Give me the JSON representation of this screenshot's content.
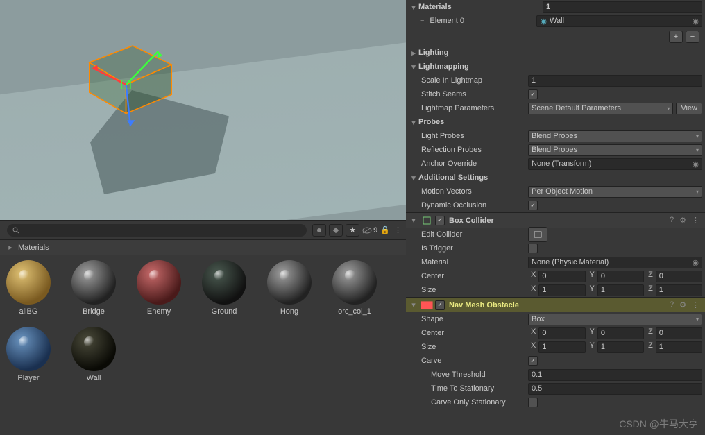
{
  "project": {
    "search_placeholder": "",
    "breadcrumb": "Materials",
    "visibility_count": "9",
    "materials": [
      {
        "name": "allBG",
        "color": "tan"
      },
      {
        "name": "Bridge",
        "color": "grey"
      },
      {
        "name": "Enemy",
        "color": "red"
      },
      {
        "name": "Ground",
        "color": "darkgreen"
      },
      {
        "name": "Hong",
        "color": "grey"
      },
      {
        "name": "orc_col_1",
        "color": "grey"
      },
      {
        "name": "Player",
        "color": "blue"
      },
      {
        "name": "Wall",
        "color": "dark"
      }
    ]
  },
  "inspector": {
    "materials": {
      "header": "Materials",
      "count": "1",
      "element0_label": "Element 0",
      "element0_value": "Wall",
      "add": "+",
      "remove": "−"
    },
    "lighting": {
      "header": "Lighting"
    },
    "lightmapping": {
      "header": "Lightmapping",
      "scale_label": "Scale In Lightmap",
      "scale": "1",
      "stitch_label": "Stitch Seams",
      "stitch_checked": "✓",
      "params_label": "Lightmap Parameters",
      "params": "Scene Default Parameters",
      "view": "View"
    },
    "probes": {
      "header": "Probes",
      "light_label": "Light Probes",
      "light": "Blend Probes",
      "refl_label": "Reflection Probes",
      "refl": "Blend Probes",
      "anchor_label": "Anchor Override",
      "anchor": "None (Transform)"
    },
    "additional": {
      "header": "Additional Settings",
      "motion_label": "Motion Vectors",
      "motion": "Per Object Motion",
      "dyn_label": "Dynamic Occlusion",
      "dyn_checked": "✓"
    },
    "boxcollider": {
      "title": "Box Collider",
      "edit_label": "Edit Collider",
      "trigger_label": "Is Trigger",
      "material_label": "Material",
      "material": "None (Physic Material)",
      "center_label": "Center",
      "center": {
        "x": "0",
        "y": "0",
        "z": "0"
      },
      "size_label": "Size",
      "size": {
        "x": "1",
        "y": "1",
        "z": "1"
      }
    },
    "navmesh": {
      "title": "Nav Mesh Obstacle",
      "shape_label": "Shape",
      "shape": "Box",
      "center_label": "Center",
      "center": {
        "x": "0",
        "y": "0",
        "z": "0"
      },
      "size_label": "Size",
      "size": {
        "x": "1",
        "y": "1",
        "z": "1"
      },
      "carve_label": "Carve",
      "carve_checked": "✓",
      "move_label": "Move Threshold",
      "move": "0.1",
      "time_label": "Time To Stationary",
      "time": "0.5",
      "carveonly_label": "Carve Only Stationary"
    }
  },
  "watermark": "CSDN @牛马大亨"
}
